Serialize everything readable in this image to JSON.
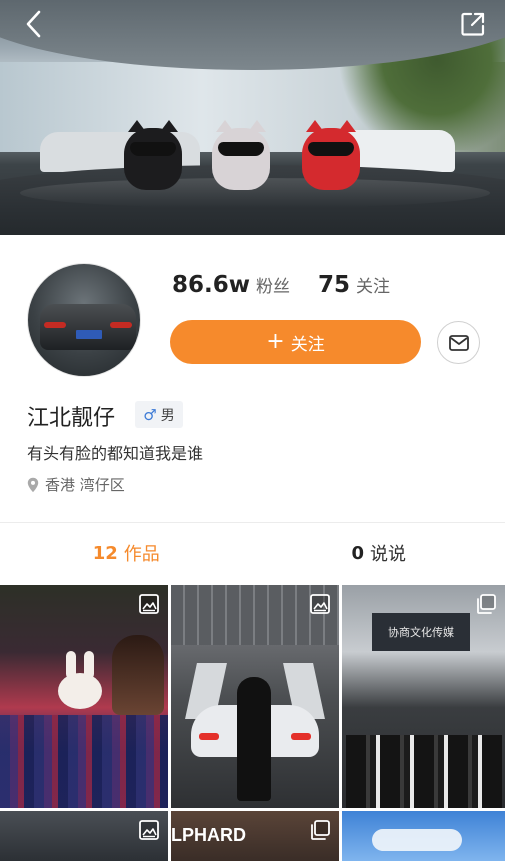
{
  "profile": {
    "fans_count": "86.6w",
    "fans_label": "粉丝",
    "following_count": "75",
    "following_label": "关注",
    "follow_button_plus": "+",
    "follow_button_label": "关注",
    "name": "江北靓仔",
    "gender_symbol": "♂",
    "gender_label": "男",
    "bio": "有头有脸的都知道我是谁",
    "location": "香港 湾仔区"
  },
  "tabs": [
    {
      "count": "12",
      "label": "作品",
      "active": true
    },
    {
      "count": "0",
      "label": "说说",
      "active": false
    }
  ],
  "grid": {
    "tile3_sign_text": "协商文化传媒",
    "tile5_overlay_text": "LPHARD"
  },
  "colors": {
    "accent": "#f68a2c",
    "active_tab": "#f58a2c",
    "gender_symbol": "#3d7bd6"
  },
  "icons": {
    "back": "chevron-left-icon",
    "share": "external-link-icon",
    "message": "mail-icon",
    "location": "location-pin-icon",
    "photo_badge": "image-icon",
    "multi_badge": "multi-image-icon"
  }
}
